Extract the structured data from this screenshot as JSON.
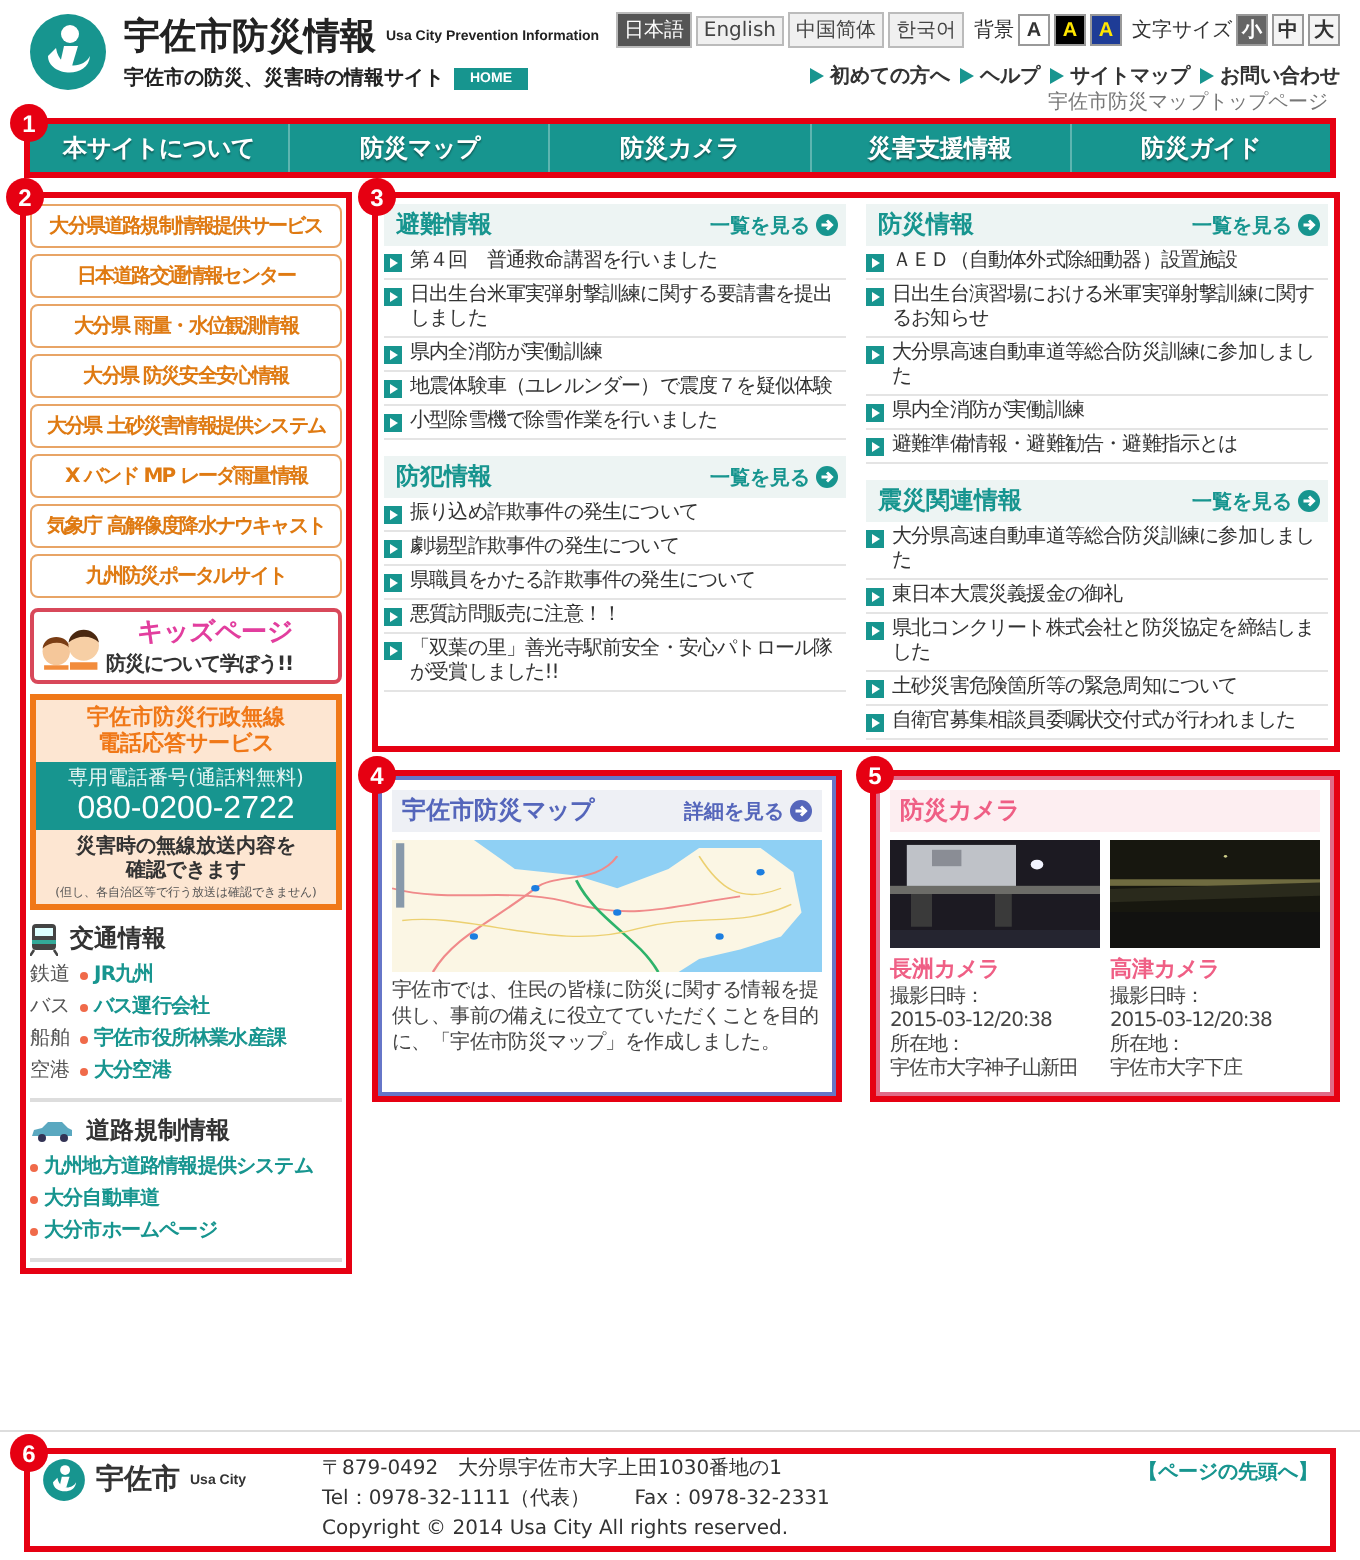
{
  "header": {
    "title": "宇佐市防災情報",
    "title_en": "Usa City Prevention Information",
    "tagline": "宇佐市の防災、災害時の情報サイト",
    "home": "HOME",
    "languages": [
      {
        "label": "日本語",
        "selected": true
      },
      {
        "label": "English",
        "selected": false
      },
      {
        "label": "中国简体",
        "selected": false
      },
      {
        "label": "한국어",
        "selected": false
      }
    ],
    "background": {
      "label": "背景",
      "options": [
        {
          "label": "A",
          "color": "#ffffff"
        },
        {
          "label": "A",
          "color": "#000000"
        },
        {
          "label": "A",
          "color": "#1e3c96"
        }
      ]
    },
    "text_size": {
      "label": "文字サイズ",
      "options": [
        {
          "label": "小",
          "selected": true
        },
        {
          "label": "中",
          "selected": false
        },
        {
          "label": "大",
          "selected": false
        }
      ]
    },
    "links": [
      "初めての方へ",
      "ヘルプ",
      "サイトマップ",
      "お問い合わせ"
    ]
  },
  "breadcrumb": "宇佐市防災マップトップページ",
  "nav": {
    "marker": "1",
    "items": [
      "本サイトについて",
      "防災マップ",
      "防災カメラ",
      "災害支援情報",
      "防災ガイド"
    ]
  },
  "sidebar": {
    "marker": "2",
    "links": [
      "大分県道路規制情報提供サービス",
      "日本道路交通情報センター",
      "大分県 雨量・水位観測情報",
      "大分県 防災安全安心情報",
      "大分県 土砂災害情報提供システム",
      "X バンド MP レーダ雨量情報",
      "気象庁 高解像度降水ナウキャスト",
      "九州防災ポータルサイト"
    ],
    "kids": {
      "title": "キッズページ",
      "subtitle": "防災について学ぼう!!"
    },
    "radio_service": {
      "title_lines": [
        "宇佐市防災行政無線",
        "電話応答サービス"
      ],
      "phone_label": "専用電話番号(通話料無料)",
      "phone": "080-0200-2722",
      "text_lines": [
        "災害時の無線放送内容を",
        "確認できます"
      ],
      "note": "(但し、各自治区等で行う放送は確認できません)"
    },
    "traffic": {
      "title": "交通情報",
      "items": [
        {
          "category": "鉄道",
          "link": "JR九州"
        },
        {
          "category": "バス",
          "link": "バス運行会社"
        },
        {
          "category": "船舶",
          "link": "宇佐市役所林業水産課"
        },
        {
          "category": "空港",
          "link": "大分空港"
        }
      ]
    },
    "road": {
      "title": "道路規制情報",
      "links": [
        "九州地方道路情報提供システム",
        "大分自動車道",
        "大分市ホームページ"
      ]
    }
  },
  "news": {
    "marker": "3",
    "columns": [
      [
        {
          "title": "避難情報",
          "more": "一覧を見る",
          "items": [
            "第４回　普通救命講習を行いました",
            "日出生台米軍実弾射撃訓練に関する要請書を提出しました",
            "県内全消防が実働訓練",
            "地震体験車（ユレルンダー）で震度７を疑似体験",
            "小型除雪機で除雪作業を行いました"
          ]
        },
        {
          "title": "防犯情報",
          "more": "一覧を見る",
          "items": [
            "振り込め詐欺事件の発生について",
            "劇場型詐欺事件の発生について",
            "県職員をかたる詐欺事件の発生について",
            "悪質訪問販売に注意！！",
            "「双葉の里」善光寺駅前安全・安心パトロール隊が受賞しました!!"
          ]
        }
      ],
      [
        {
          "title": "防災情報",
          "more": "一覧を見る",
          "items": [
            "ＡＥＤ（自動体外式除細動器）設置施設",
            "日出生台演習場における米軍実弾射撃訓練に関するお知らせ",
            "大分県高速自動車道等総合防災訓練に参加しました",
            "県内全消防が実働訓練",
            "避難準備情報・避難勧告・避難指示とは"
          ]
        },
        {
          "title": "震災関連情報",
          "more": "一覧を見る",
          "items": [
            "大分県高速自動車道等総合防災訓練に参加しました",
            "東日本大震災義援金の御礼",
            "県北コンクリート株式会社と防災協定を締結しました",
            "土砂災害危険箇所等の緊急周知について",
            "自衛官募集相談員委嘱状交付式が行われました"
          ]
        }
      ]
    ]
  },
  "map_panel": {
    "marker": "4",
    "title": "宇佐市防災マップ",
    "more": "詳細を見る",
    "description": "宇佐市では、住民の皆様に防災に関する情報を提供し、事前の備えに役立てていただくことを目的に、「宇佐市防災マップ」を作成しました。"
  },
  "camera_panel": {
    "marker": "5",
    "title": "防災カメラ",
    "cameras": [
      {
        "name": "長洲カメラ",
        "date_label": "撮影日時：",
        "date": "2015-03-12/20:38",
        "place_label": "所在地：",
        "place": "宇佐市大字神子山新田"
      },
      {
        "name": "高津カメラ",
        "date_label": "撮影日時：",
        "date": "2015-03-12/20:38",
        "place_label": "所在地：",
        "place": "宇佐市大字下庄"
      }
    ]
  },
  "footer": {
    "marker": "6",
    "logo": "宇佐市",
    "logo_en": "Usa City",
    "address": "〒879-0492　大分県宇佐市大字上田1030番地の1",
    "tel": "Tel：0978-32-1111（代表）",
    "fax": "Fax：0978-32-2331",
    "copyright": "Copyright © 2014 Usa City All rights reserved.",
    "page_top": "【ページの先頭へ】"
  }
}
